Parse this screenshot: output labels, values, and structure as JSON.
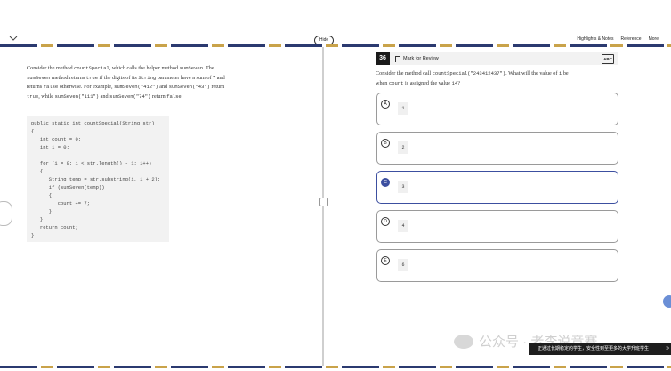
{
  "header": {
    "hide_label": "Hide",
    "links": [
      "Highlights & Notes",
      "Reference",
      "More"
    ]
  },
  "passage": {
    "line1_a": "Consider the method ",
    "line1_code": "countSpecial",
    "line1_b": ", which calls the helper method ",
    "line1_code2": "sumSeven",
    "line1_c": ". The",
    "line2_code": "sumSeven",
    "line2_a": " method returns ",
    "line2_code2": "true",
    "line2_b": " if the digits of its ",
    "line2_code3": "String",
    "line2_c": " parameter have a sum of 7 and",
    "line3_a": "returns ",
    "line3_code": "false",
    "line3_b": " otherwise. For example, ",
    "line3_code2": "sumSeven(\"412\")",
    "line3_c": " and ",
    "line3_code3": "sumSeven(\"43\")",
    "line3_d": " return",
    "line4_code": "true",
    "line4_a": ", while ",
    "line4_code2": "sumSeven(\"111\")",
    "line4_b": " and ",
    "line4_code3": "sumSeven(\"74\")",
    "line4_c": " return ",
    "line4_code4": "false",
    "line4_d": "."
  },
  "code_lines": [
    "public static int countSpecial(String str)",
    "{",
    "   int count = 0;",
    "   int i = 0;",
    "",
    "   for (i = 0; i < str.length() - 1; i++)",
    "   {",
    "      String temp = str.substring(i, i + 2);",
    "      if (sumSeven(temp))",
    "      {",
    "         count += 7;",
    "      }",
    "   }",
    "   return count;",
    "}"
  ],
  "question": {
    "number": "36",
    "mark_label": "Mark for Review",
    "abc_label": "ABC",
    "text_a": "Consider the method call ",
    "text_code": "countSpecial(\"243412437\")",
    "text_b": ". What will the value of ",
    "text_code2": "i",
    "text_c": " be",
    "text_line2_a": "when ",
    "text_line2_code": "count",
    "text_line2_b": " is assigned the value ",
    "text_line2_code2": "14",
    "text_line2_c": "?"
  },
  "choices": [
    {
      "letter": "A",
      "value": "1",
      "selected": false
    },
    {
      "letter": "B",
      "value": "2",
      "selected": false
    },
    {
      "letter": "C",
      "value": "3",
      "selected": true
    },
    {
      "letter": "D",
      "value": "4",
      "selected": false
    },
    {
      "letter": "E",
      "value": "6",
      "selected": false
    }
  ],
  "watermark": {
    "text": "公众号 · 老李说竞赛"
  },
  "banner": {
    "text": "正通过长期稳定的学生，安全性到至更多的大学升班学生",
    "arrow": "»"
  },
  "colors": {
    "accent": "#3c4fa0",
    "stripe_dark": "#2b3a70",
    "stripe_gold": "#c9a34a"
  }
}
